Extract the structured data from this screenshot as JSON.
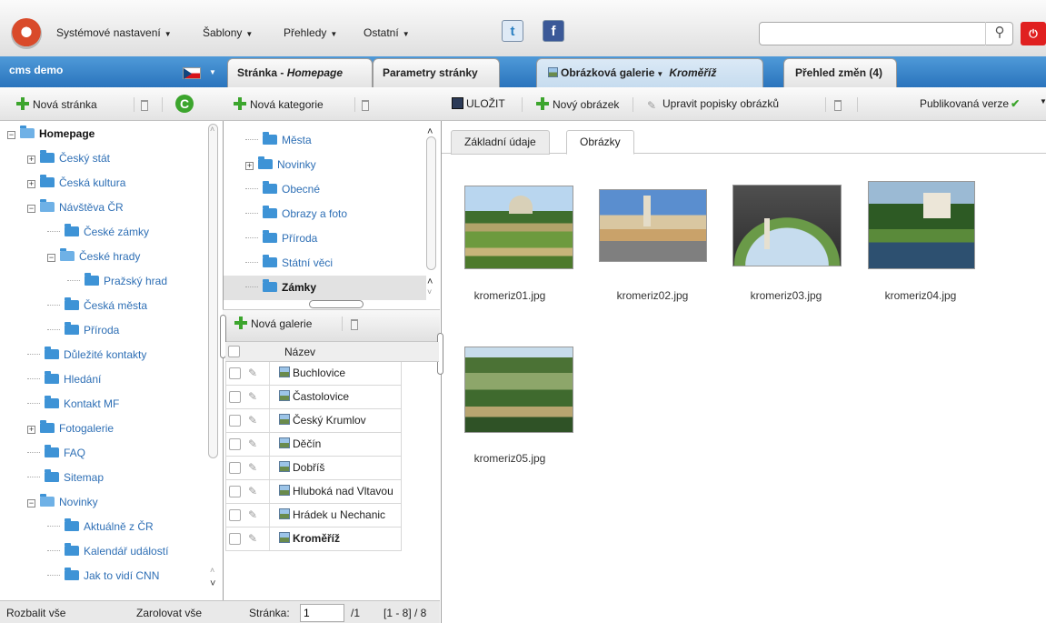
{
  "topbar": {
    "menus": [
      "Systémové nastavení",
      "Šablony",
      "Přehledy",
      "Ostatní"
    ],
    "twitter_glyph": "t",
    "facebook_glyph": "f",
    "search_placeholder": "",
    "search_icon": "⚲",
    "power_icon": "⏻"
  },
  "site": {
    "name": "cms demo"
  },
  "tabs": [
    {
      "label": "Stránka - Homepage",
      "prefix": "Stránka - ",
      "italic": "Homepage"
    },
    {
      "label": "Parametry stránky"
    },
    {
      "label": "Obrázková galerie",
      "suffix": "Kroměříž",
      "active": true
    },
    {
      "label": "Přehled změn (4)"
    }
  ],
  "toolbar_left": {
    "new_page": "Nová stránka"
  },
  "toolbar_mid": {
    "new_category": "Nová kategorie"
  },
  "toolbar_right": {
    "save": "ULOŽIT",
    "new_image": "Nový obrázek",
    "edit_captions": "Upravit popisky obrázků",
    "published_version": "Publikovaná verze"
  },
  "tree": [
    {
      "label": "Homepage",
      "bold": true,
      "expander": "−",
      "folder": "open",
      "indent": 0
    },
    {
      "label": "Český stát",
      "expander": "+",
      "indent": 1
    },
    {
      "label": "Česká kultura",
      "expander": "+",
      "indent": 1
    },
    {
      "label": "Návštěva ČR",
      "expander": "−",
      "folder": "open",
      "indent": 1
    },
    {
      "label": "České zámky",
      "indent": 2
    },
    {
      "label": "České hrady",
      "expander": "−",
      "folder": "open",
      "indent": 2
    },
    {
      "label": "Pražský hrad",
      "indent": 3
    },
    {
      "label": "Česká města",
      "indent": 2
    },
    {
      "label": "Příroda",
      "indent": 2
    },
    {
      "label": "Důležité kontakty",
      "indent": 1
    },
    {
      "label": "Hledání",
      "indent": 1
    },
    {
      "label": "Kontakt MF",
      "indent": 1
    },
    {
      "label": "Fotogalerie",
      "expander": "+",
      "indent": 1
    },
    {
      "label": "FAQ",
      "indent": 1
    },
    {
      "label": "Sitemap",
      "indent": 1
    },
    {
      "label": "Novinky",
      "expander": "−",
      "folder": "open",
      "indent": 1
    },
    {
      "label": "Aktuálně z ČR",
      "indent": 2
    },
    {
      "label": "Kalendář událostí",
      "indent": 2
    },
    {
      "label": "Jak to vidí CNN",
      "indent": 2
    }
  ],
  "tree_footer": {
    "expand_all": "Rozbalit vše",
    "collapse_all": "Zarolovat vše"
  },
  "categories": [
    {
      "label": "Města"
    },
    {
      "label": "Novinky",
      "expander": "+"
    },
    {
      "label": "Obecné"
    },
    {
      "label": "Obrazy a foto"
    },
    {
      "label": "Příroda"
    },
    {
      "label": "Státní věci"
    },
    {
      "label": "Zámky",
      "selected": true
    }
  ],
  "galleries": {
    "new_gallery": "Nová galerie",
    "column_name": "Název",
    "rows": [
      "Buchlovice",
      "Častolovice",
      "Český Krumlov",
      "Děčín",
      "Dobříš",
      "Hluboká nad Vltavou",
      "Hrádek u Nechanic",
      "Kroměříž"
    ],
    "selected": "Kroměříž"
  },
  "pager": {
    "label": "Stránka:",
    "page": "1",
    "total": "/1",
    "range": "[1 - 8] / 8"
  },
  "subtabs": [
    "Základní údaje",
    "Obrázky"
  ],
  "images": [
    "kromeriz01.jpg",
    "kromeriz02.jpg",
    "kromeriz03.jpg",
    "kromeriz04.jpg",
    "kromeriz05.jpg"
  ],
  "colors": {
    "accent_blue": "#2a74bd",
    "plus_green": "#3ca52d",
    "power_red": "#e02020"
  }
}
